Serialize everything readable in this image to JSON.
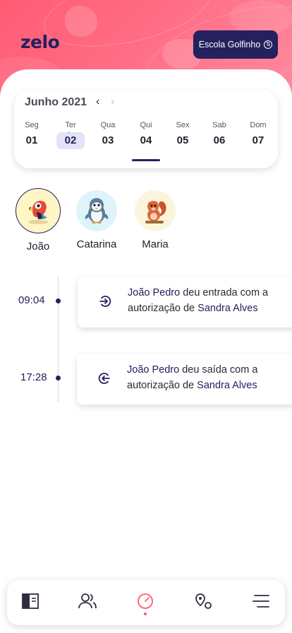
{
  "app": {
    "logo": "zelo",
    "school_button": "Escola Golfinho",
    "accent": "#ff5b74",
    "brand": "#24215e"
  },
  "calendar": {
    "month": "Junho 2021",
    "days": [
      {
        "name": "Seg",
        "date": "01"
      },
      {
        "name": "Ter",
        "date": "02"
      },
      {
        "name": "Qua",
        "date": "03"
      },
      {
        "name": "Qui",
        "date": "04"
      },
      {
        "name": "Sex",
        "date": "05"
      },
      {
        "name": "Sab",
        "date": "06"
      },
      {
        "name": "Dom",
        "date": "07"
      }
    ],
    "selected": "02",
    "today": "04"
  },
  "kids": [
    {
      "name": "João",
      "avatar": "parrot-icon"
    },
    {
      "name": "Catarina",
      "avatar": "penguin-icon"
    },
    {
      "name": "Maria",
      "avatar": "squirrel-icon"
    }
  ],
  "timeline": [
    {
      "time": "09:04",
      "icon": "login-icon",
      "person": "João Pedro",
      "action": " deu entrada com a autorização de ",
      "guardian": "Sandra Alves"
    },
    {
      "time": "17:28",
      "icon": "logout-icon",
      "person": "João Pedro",
      "action": " deu saída com a autorização de ",
      "guardian": "Sandra Alves"
    }
  ],
  "bottom_nav": [
    {
      "icon": "book-icon"
    },
    {
      "icon": "users-icon"
    },
    {
      "icon": "clock-icon",
      "active": true
    },
    {
      "icon": "map-pin-icon"
    },
    {
      "icon": "menu-icon"
    }
  ]
}
